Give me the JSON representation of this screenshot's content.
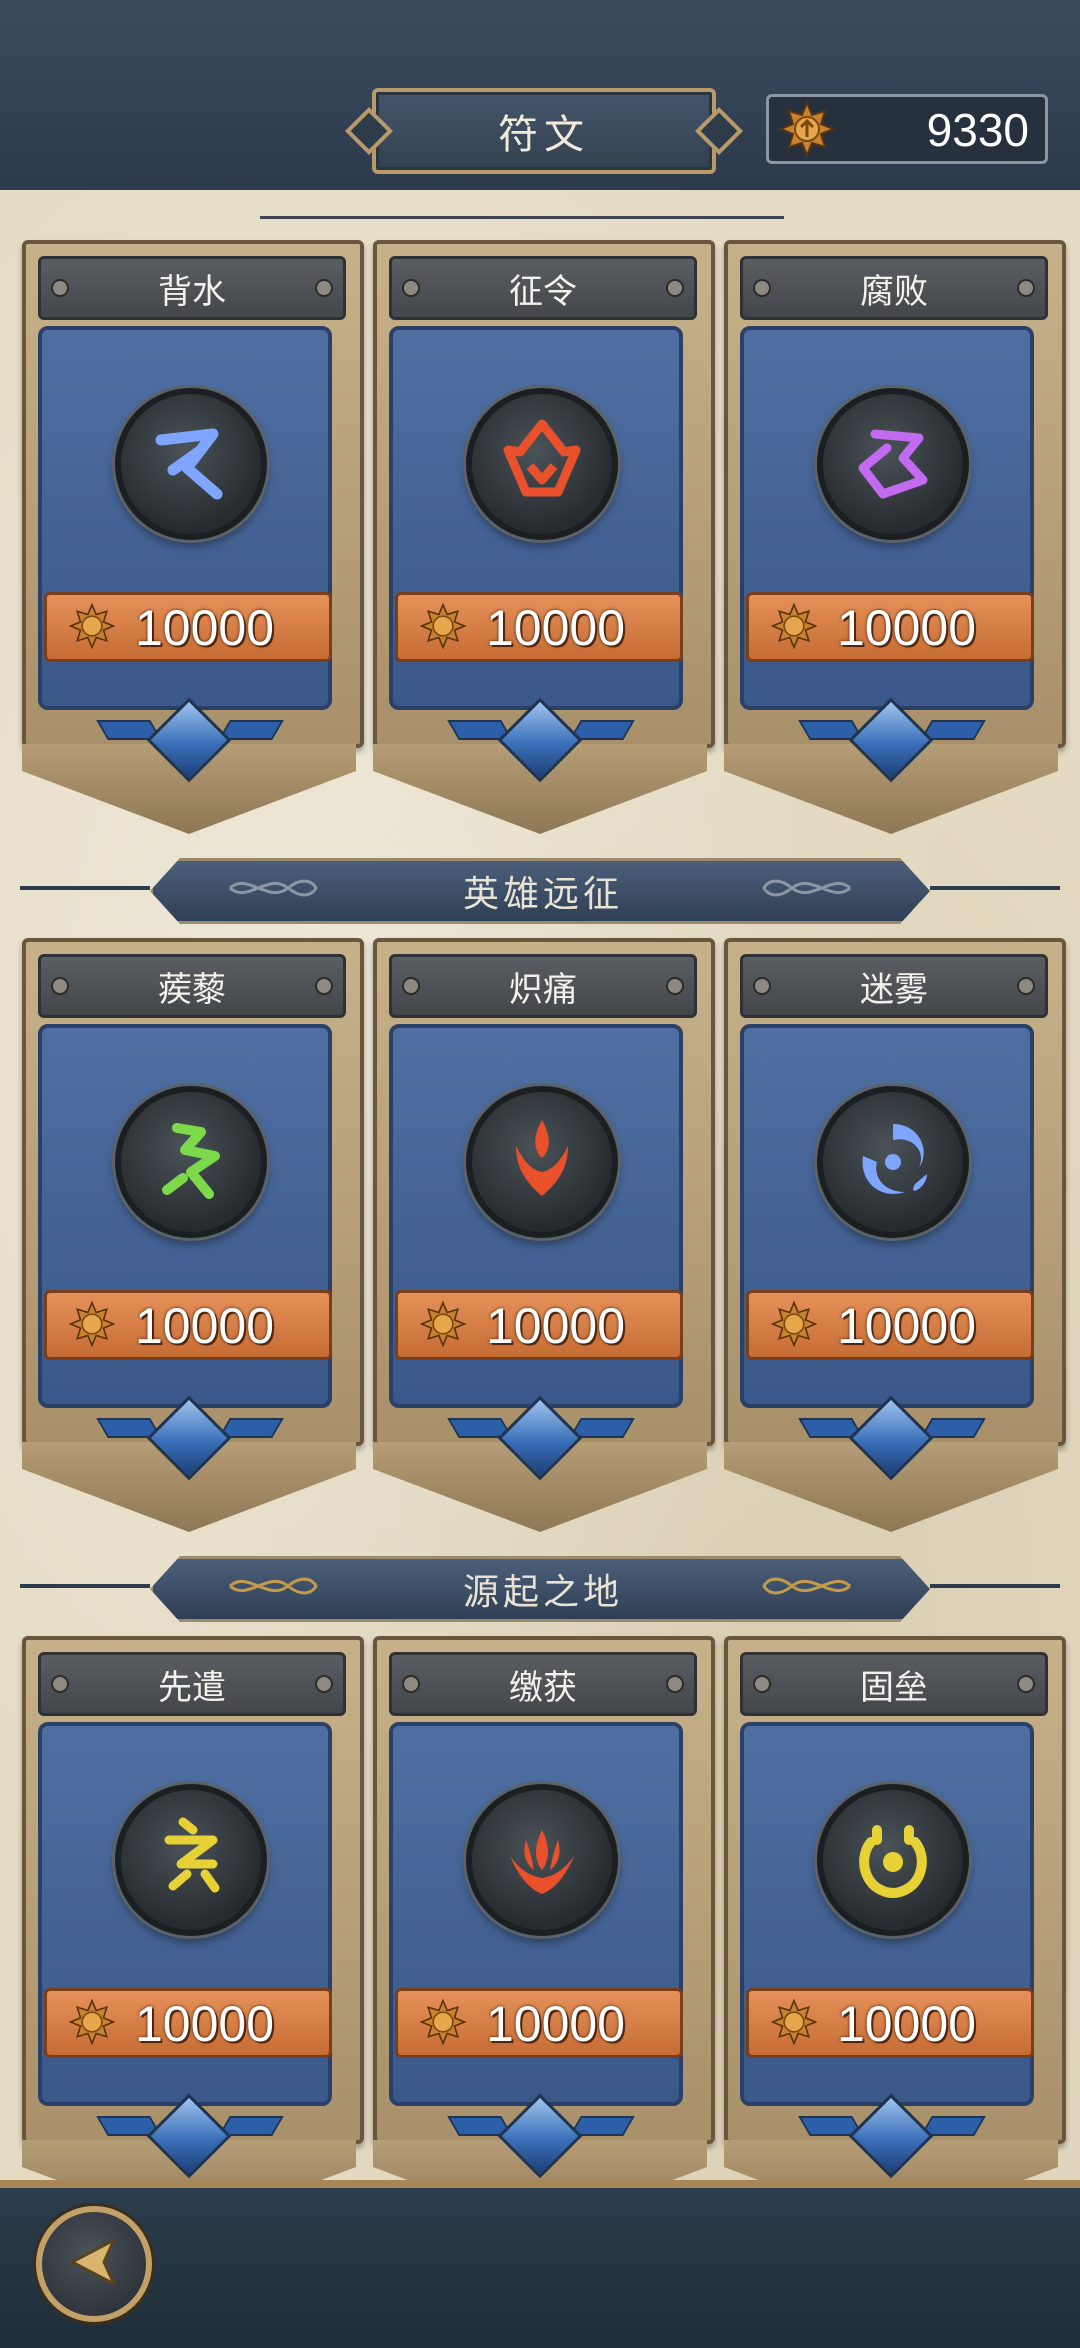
{
  "header": {
    "title": "符文",
    "currency_icon": "gold-sun-coin-icon",
    "currency_value": "9330"
  },
  "sections": [
    {
      "banner": "",
      "runes": [
        {
          "name": "背水",
          "price": "10000",
          "glyph": "blue-rune-icon",
          "color": "#7fa6ff"
        },
        {
          "name": "征令",
          "price": "10000",
          "glyph": "red-crown-rune-icon",
          "color": "#e8512b"
        },
        {
          "name": "腐败",
          "price": "10000",
          "glyph": "purple-rune-icon",
          "color": "#c26bf0"
        }
      ]
    },
    {
      "banner": "英雄远征",
      "runes": [
        {
          "name": "蒺藜",
          "price": "10000",
          "glyph": "green-zigzag-rune-icon",
          "color": "#7cd94a"
        },
        {
          "name": "炽痛",
          "price": "10000",
          "glyph": "red-flame-rune-icon",
          "color": "#e8512b"
        },
        {
          "name": "迷雾",
          "price": "10000",
          "glyph": "blue-swirl-rune-icon",
          "color": "#7fa6ff"
        }
      ]
    },
    {
      "banner": "源起之地",
      "runes": [
        {
          "name": "先遣",
          "price": "10000",
          "glyph": "yellow-glyph-rune-icon",
          "color": "#e6d237"
        },
        {
          "name": "缴获",
          "price": "10000",
          "glyph": "red-lotus-rune-icon",
          "color": "#e8512b"
        },
        {
          "name": "固垒",
          "price": "10000",
          "glyph": "yellow-ring-rune-icon",
          "color": "#e6d237"
        }
      ]
    }
  ],
  "footer": {
    "back_icon": "back-arrow-icon"
  }
}
